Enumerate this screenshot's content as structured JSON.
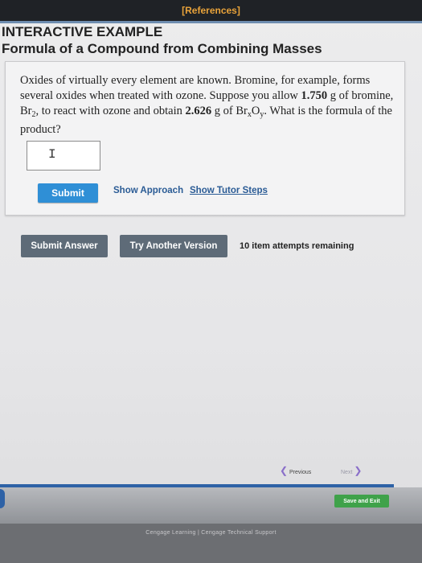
{
  "header": {
    "references_link": "[References]"
  },
  "titles": {
    "section": "INTERACTIVE EXAMPLE",
    "problem": "Formula of a Compound from Combining Masses"
  },
  "question": {
    "line1_a": "Oxides of virtually every element are known. Bromine, for example, forms several oxides when treated with ozone. Suppose you allow ",
    "bromine_mass": "1.750",
    "line1_b": " g of bromine, Br",
    "br2_sub": "2",
    "line1_c": ", to react with ozone and obtain ",
    "product_mass": "2.626",
    "line1_d": " g of Br",
    "x_sub": "x",
    "line1_e": "O",
    "y_sub": "y",
    "line1_f": ". What is the formula of the product?"
  },
  "answer": {
    "value": ""
  },
  "panel_actions": {
    "submit_label": "Submit",
    "show_approach": "Show Approach",
    "show_tutor_steps": "Show Tutor Steps"
  },
  "footer_actions": {
    "submit_answer": "Submit Answer",
    "try_another": "Try Another Version",
    "attempts": "10 item attempts remaining"
  },
  "navigation": {
    "previous": "Previous",
    "next": "Next",
    "save_exit": "Save and Exit"
  },
  "footer": {
    "text": "Cengage Learning | Cengage Technical Support"
  },
  "colors": {
    "references": "#e9a33a",
    "submit_button": "#2f8fd6",
    "dark_button": "#5e6b78",
    "link": "#2a5b95",
    "save_exit": "#3fa24a"
  }
}
